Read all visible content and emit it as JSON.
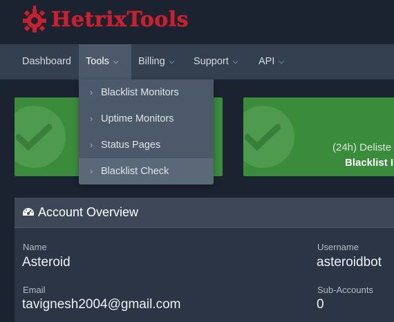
{
  "brand": {
    "name": "HetrixTools",
    "color": "#c8202f"
  },
  "nav": {
    "items": [
      {
        "label": "Dashboard",
        "has_caret": false
      },
      {
        "label": "Tools",
        "has_caret": true,
        "active": true
      },
      {
        "label": "Billing",
        "has_caret": true
      },
      {
        "label": "Support",
        "has_caret": true
      },
      {
        "label": "API",
        "has_caret": true
      }
    ]
  },
  "tools_menu": {
    "items": [
      {
        "label": "Blacklist Monitors"
      },
      {
        "label": "Uptime Monitors"
      },
      {
        "label": "Status Pages"
      },
      {
        "label": "Blacklist Check",
        "hovered": true
      }
    ]
  },
  "stat_cards": [
    {
      "line1": "",
      "line2": "",
      "status_icon": "checkmark-icon"
    },
    {
      "line1": "(24h) Deliste",
      "line2": "Blacklist I",
      "status_icon": "checkmark-icon"
    }
  ],
  "account_overview": {
    "title": "Account Overview",
    "icon": "dashboard-gauge-icon",
    "fields": {
      "name": {
        "label": "Name",
        "value": "Asteroid"
      },
      "username": {
        "label": "Username",
        "value": "asteroidbot"
      },
      "email": {
        "label": "Email",
        "value": "tavignesh2004@gmail.com"
      },
      "sub_accounts": {
        "label": "Sub-Accounts",
        "value": "0"
      }
    }
  },
  "colors": {
    "background": "#1b2331",
    "nav_bar": "#343f4f",
    "nav_active": "#4c596a",
    "success_card": "#3a8b3c",
    "panel": "#2b3545"
  }
}
